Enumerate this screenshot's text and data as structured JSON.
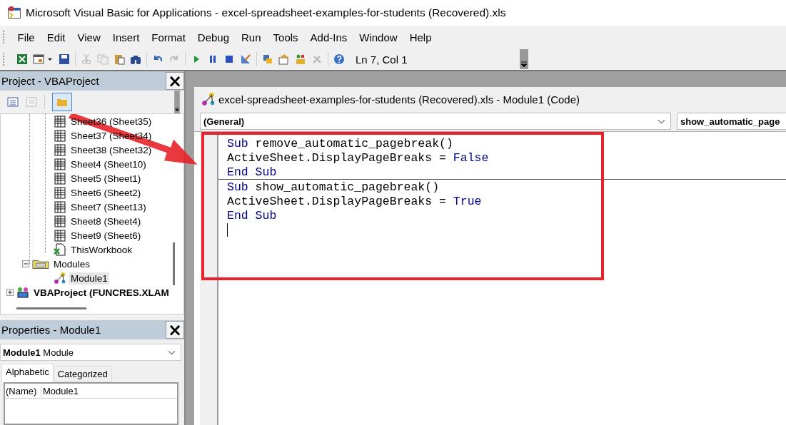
{
  "window": {
    "title": "Microsoft Visual Basic for Applications - excel-spreadsheet-examples-for-students (Recovered).xls"
  },
  "menu": [
    {
      "label": "File"
    },
    {
      "label": "Edit"
    },
    {
      "label": "View"
    },
    {
      "label": "Insert"
    },
    {
      "label": "Format"
    },
    {
      "label": "Debug"
    },
    {
      "label": "Run"
    },
    {
      "label": "Tools"
    },
    {
      "label": "Add-Ins"
    },
    {
      "label": "Window"
    },
    {
      "label": "Help"
    }
  ],
  "toolbar": {
    "position": "Ln 7, Col 1"
  },
  "project": {
    "title": "Project - VBAProject",
    "close": "×",
    "tree": [
      {
        "children": [
          {
            "children": [
              {
                "label": "Sheet36 (Sheet35)",
                "kind": "sheet",
                "selected": false
              },
              {
                "label": "Sheet37 (Sheet34)",
                "kind": "sheet",
                "selected": false
              },
              {
                "label": "Sheet38 (Sheet32)",
                "kind": "sheet",
                "selected": false
              },
              {
                "label": "Sheet4 (Sheet10)",
                "kind": "sheet",
                "selected": false
              },
              {
                "label": "Sheet5 (Sheet1)",
                "kind": "sheet",
                "selected": false
              },
              {
                "label": "Sheet6 (Sheet2)",
                "kind": "sheet",
                "selected": false
              },
              {
                "label": "Sheet7 (Sheet13)",
                "kind": "sheet",
                "selected": false
              },
              {
                "label": "Sheet8 (Sheet4)",
                "kind": "sheet",
                "selected": false
              },
              {
                "label": "Sheet9 (Sheet6)",
                "kind": "sheet",
                "selected": false
              },
              {
                "label": "ThisWorkbook",
                "kind": "workbook",
                "selected": false
              }
            ]
          },
          {
            "label": "Modules",
            "kind": "folder",
            "expanded": true,
            "selected": false,
            "children": [
              {
                "label": "Module1",
                "kind": "module",
                "selected": true
              }
            ]
          }
        ]
      },
      {
        "label": "VBAProject (FUNCRES.XLAM",
        "kind": "project",
        "expanded": false,
        "selected": false
      }
    ]
  },
  "properties": {
    "title": "Properties - Module1",
    "close": "×",
    "object_name": "Module1",
    "object_type": "Module",
    "tabs": [
      {
        "label": "Alphabetic",
        "selected": true
      },
      {
        "label": "Categorized",
        "selected": false
      }
    ],
    "rows": [
      {
        "name": "(Name)",
        "value": "Module1"
      }
    ]
  },
  "code_window": {
    "title": "excel-spreadsheet-examples-for-students (Recovered).xls - Module1 (Code)",
    "object": "(General)",
    "procedure": "show_automatic_page",
    "lines": [
      {
        "tokens": [
          {
            "text": "Sub",
            "kind": "keyword"
          },
          {
            "text": " remove_automatic_pagebreak()",
            "kind": "plain"
          }
        ],
        "separator": false
      },
      {
        "tokens": [
          {
            "text": "ActiveSheet.DisplayPageBreaks = ",
            "kind": "plain"
          },
          {
            "text": "False",
            "kind": "keyword"
          }
        ],
        "separator": false
      },
      {
        "tokens": [
          {
            "text": "End Sub",
            "kind": "keyword"
          }
        ],
        "separator": false
      },
      {
        "tokens": [
          {
            "text": "Sub",
            "kind": "keyword"
          },
          {
            "text": " show_automatic_pagebreak()",
            "kind": "plain"
          }
        ],
        "separator": true
      },
      {
        "tokens": [
          {
            "text": "ActiveSheet.DisplayPageBreaks = ",
            "kind": "plain"
          },
          {
            "text": "True",
            "kind": "keyword"
          }
        ],
        "separator": false
      },
      {
        "tokens": [
          {
            "text": "End Sub",
            "kind": "keyword"
          }
        ],
        "separator": false
      },
      {
        "separator": false,
        "cursor": true
      }
    ]
  }
}
